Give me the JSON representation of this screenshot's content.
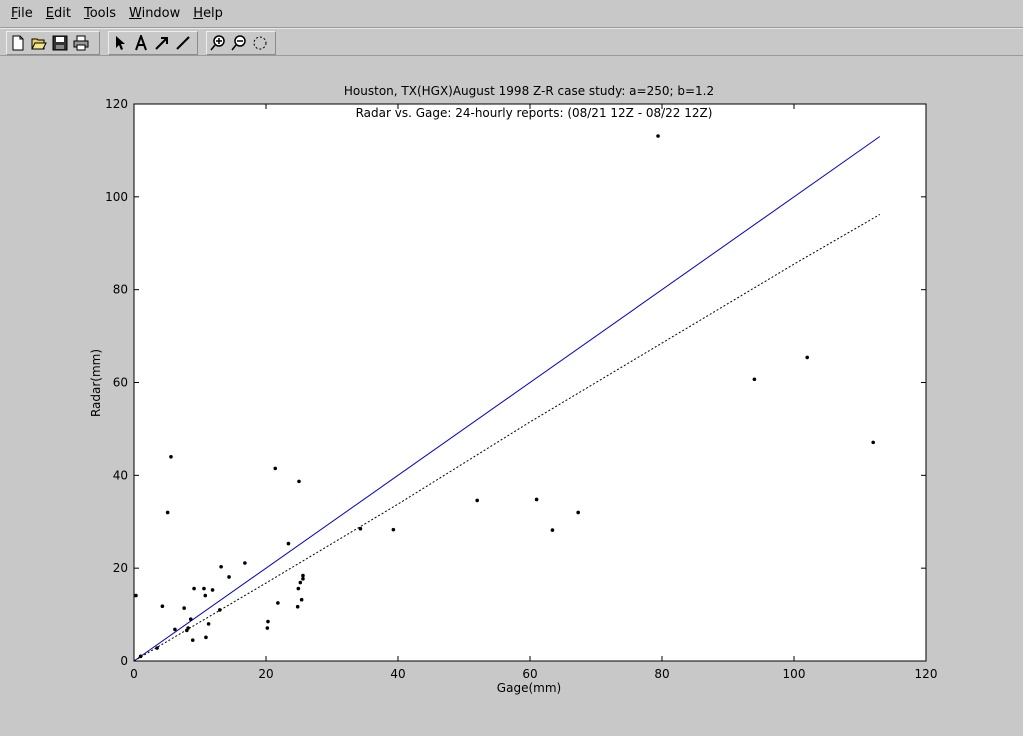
{
  "menu": {
    "items": [
      "File",
      "Edit",
      "Tools",
      "Window",
      "Help"
    ]
  },
  "toolbar": {
    "buttons": [
      "new-file-icon",
      "open-folder-icon",
      "save-icon",
      "print-icon",
      "pointer-icon",
      "text-icon",
      "arrow-icon",
      "line-icon",
      "zoom-in-icon",
      "zoom-out-icon",
      "rotate-icon"
    ]
  },
  "chart_data": {
    "type": "scatter",
    "title": "Houston, TX(HGX)August 1998 Z-R case study: a=250; b=1.2",
    "subtitle": "Radar vs. Gage: 24-hourly reports: (08/21 12Z - 08/22 12Z)",
    "xlabel": "Gage(mm)",
    "ylabel": "Radar(mm)",
    "xlim": [
      0,
      120
    ],
    "ylim": [
      0,
      120
    ],
    "xticks": [
      0,
      20,
      40,
      60,
      80,
      100,
      120
    ],
    "yticks": [
      0,
      20,
      40,
      60,
      80,
      100,
      120
    ],
    "grid": false,
    "colors": {
      "blue_line": "#0000cc",
      "dotted_line": "#000000",
      "points": "#000000",
      "axes_bg": "#ffffff"
    },
    "series": [
      {
        "type": "scatter",
        "points": [
          [
            0.3,
            14.1
          ],
          [
            1.0,
            1.0
          ],
          [
            3.5,
            2.8
          ],
          [
            4.3,
            11.8
          ],
          [
            5.1,
            32.0
          ],
          [
            5.6,
            44.0
          ],
          [
            6.2,
            6.8
          ],
          [
            7.6,
            11.4
          ],
          [
            8.0,
            6.6
          ],
          [
            8.2,
            7.1
          ],
          [
            8.6,
            9.0
          ],
          [
            8.9,
            4.5
          ],
          [
            9.1,
            15.6
          ],
          [
            10.6,
            15.6
          ],
          [
            10.8,
            14.1
          ],
          [
            10.9,
            5.1
          ],
          [
            11.3,
            8.0
          ],
          [
            11.9,
            15.3
          ],
          [
            13.0,
            11.0
          ],
          [
            13.2,
            20.3
          ],
          [
            14.4,
            18.1
          ],
          [
            16.8,
            21.1
          ],
          [
            20.2,
            7.1
          ],
          [
            20.3,
            8.5
          ],
          [
            21.4,
            41.5
          ],
          [
            21.8,
            12.5
          ],
          [
            23.4,
            25.3
          ],
          [
            24.8,
            11.7
          ],
          [
            24.9,
            15.6
          ],
          [
            25.0,
            38.7
          ],
          [
            25.2,
            16.9
          ],
          [
            25.4,
            13.2
          ],
          [
            25.6,
            17.7
          ],
          [
            25.6,
            18.4
          ],
          [
            34.3,
            28.5
          ],
          [
            39.3,
            28.3
          ],
          [
            52.0,
            34.6
          ],
          [
            61.0,
            34.8
          ],
          [
            63.4,
            28.2
          ],
          [
            67.3,
            32.0
          ],
          [
            79.4,
            113.1
          ],
          [
            94.0,
            60.7
          ],
          [
            102.0,
            65.4
          ],
          [
            112.0,
            47.1
          ]
        ]
      },
      {
        "type": "line",
        "style": "solid",
        "color": "#0000cc",
        "x": [
          0,
          113
        ],
        "y": [
          0,
          113
        ]
      },
      {
        "type": "line",
        "style": "dotted",
        "color": "#000000",
        "x": [
          0,
          20,
          40,
          60,
          80,
          100,
          113
        ],
        "y": [
          0,
          16.8,
          33.8,
          51.5,
          68.5,
          85.5,
          96.2
        ]
      }
    ]
  }
}
